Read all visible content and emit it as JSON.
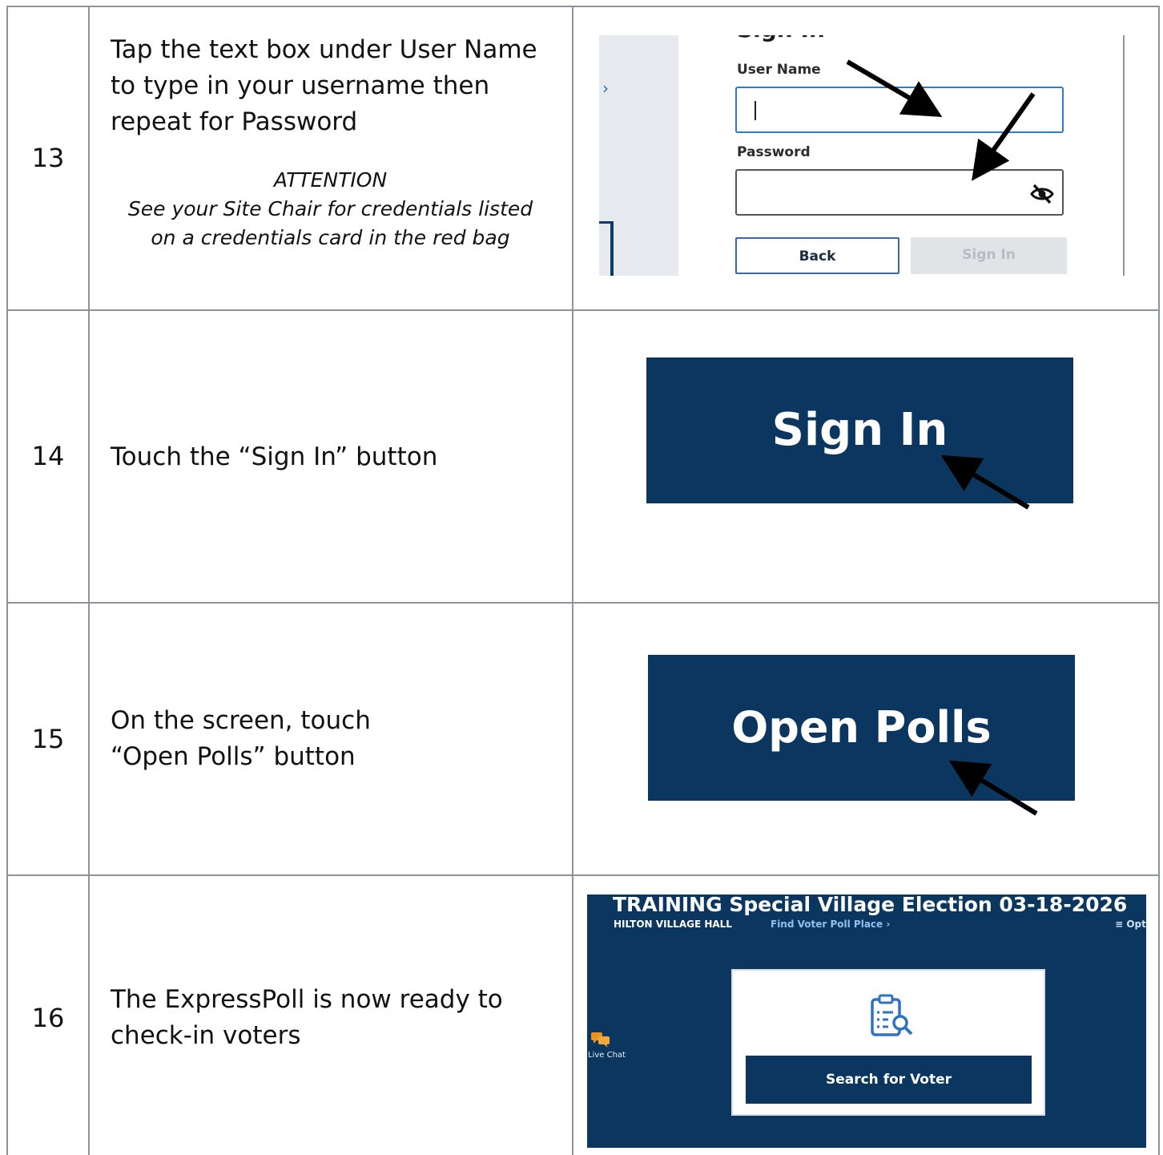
{
  "rows": [
    {
      "step": "13",
      "instruction_lines": [
        "Tap the text box under User Name",
        "to type in your username then",
        "repeat for Password"
      ],
      "note_lines": [
        "ATTENTION",
        "See your Site Chair for credentials listed",
        "on a credentials card in the red bag"
      ],
      "screenshot": {
        "title": "Sign In",
        "user_name_label": "User Name",
        "password_label": "Password",
        "back_button": "Back",
        "sign_in_button": "Sign In",
        "side_chevron": "›",
        "eye_icon": "eye-slash-icon"
      }
    },
    {
      "step": "14",
      "instruction_lines": [
        "Touch the “Sign In” button"
      ],
      "button_label": "Sign In"
    },
    {
      "step": "15",
      "instruction_lines": [
        "On the screen, touch",
        "“Open Polls” button"
      ],
      "button_label": "Open Polls"
    },
    {
      "step": "16",
      "instruction_lines": [
        "The ExpressPoll is now ready to",
        "check-in voters"
      ],
      "screenshot": {
        "election_title": "TRAINING Special Village Election 03-18-2026",
        "location": "HILTON VILLAGE HALL",
        "find_link": "Find Voter Poll Place ›",
        "options_menu": "≡ Opti",
        "live_chat": "Live Chat",
        "search_button": "Search for Voter",
        "clipboard_icon": "clipboard-search-icon",
        "chat_icon": "chat-bubbles-icon"
      }
    }
  ],
  "colors": {
    "button_navy": "#0b365f",
    "grid_line": "#8f929a",
    "field_focus": "#2e7bc9",
    "chat_orange": "#e8931c"
  }
}
